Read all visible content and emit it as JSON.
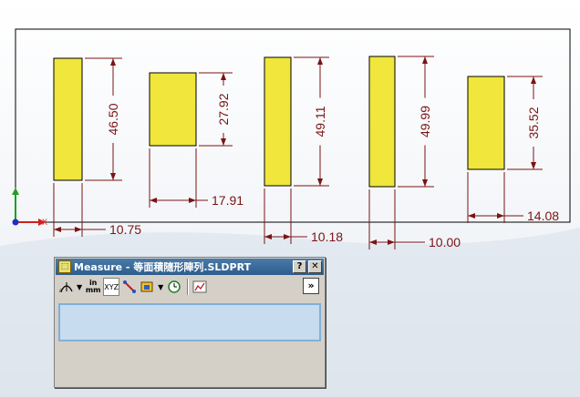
{
  "drawing": {
    "rectangles": [
      {
        "name": "rect-1",
        "height_label": "46.50",
        "width_label": "10.75"
      },
      {
        "name": "rect-2",
        "height_label": "27.92",
        "width_label": "17.91"
      },
      {
        "name": "rect-3",
        "height_label": "49.11",
        "width_label": "10.18"
      },
      {
        "name": "rect-4",
        "height_label": "49.99",
        "width_label": "10.00"
      },
      {
        "name": "rect-5",
        "height_label": "35.52",
        "width_label": "14.08"
      }
    ],
    "triad": {
      "x_label": "X"
    },
    "colors": {
      "rect_fill": "#f0e63c",
      "dimension": "#7a1414",
      "triad_x": "#d02020",
      "triad_y": "#20a020",
      "triad_z": "#2030c0"
    }
  },
  "measure": {
    "title": "Measure - 等面積隨形陣列.SLDPRT",
    "help_label": "?",
    "close_label": "✕",
    "toolbar": {
      "arc_icon": "arc-circle-icon",
      "units_top": "in",
      "units_bottom": "mm",
      "xyz_label": "XYZ",
      "point_to_point_icon": "point-to-point-icon",
      "projection_icon": "projection-icon",
      "history_icon": "history-icon",
      "sensor_icon": "sensor-icon"
    },
    "collapse_label": "»",
    "results": ""
  }
}
